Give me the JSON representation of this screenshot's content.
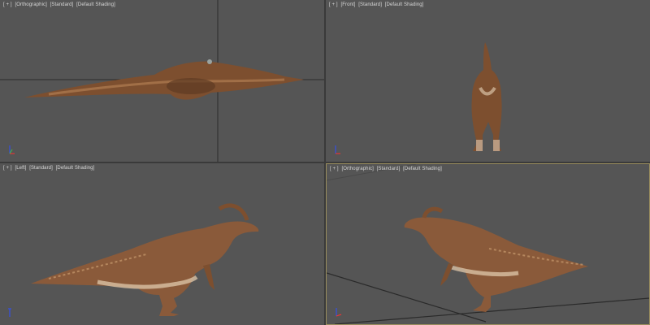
{
  "viewports": [
    {
      "id": "top",
      "menu": "[ + ]",
      "view": "[Orthographic]",
      "shading_mode": "[Standard]",
      "shading": "[Default Shading]"
    },
    {
      "id": "front",
      "menu": "[ + ]",
      "view": "[Front]",
      "shading_mode": "[Standard]",
      "shading": "[Default Shading]"
    },
    {
      "id": "left",
      "menu": "[ + ]",
      "view": "[Left]",
      "shading_mode": "[Standard]",
      "shading": "[Default Shading]"
    },
    {
      "id": "perspective",
      "menu": "[ + ]",
      "view": "[Orthographic]",
      "shading_mode": "[Standard]",
      "shading": "[Default Shading]"
    }
  ],
  "colors": {
    "viewport_bg": "#555555",
    "active_border": "#9a8e5e",
    "grid_line": "#2a2a2a",
    "dino_body": "#8a5a3a",
    "dino_belly": "#d9c2a5"
  },
  "icons": [
    "axis-gizmo-icon",
    "dinosaur-model"
  ]
}
